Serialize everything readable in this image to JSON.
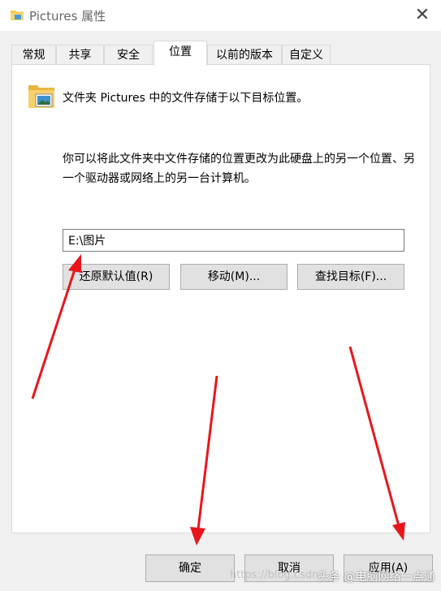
{
  "window": {
    "title": "Pictures 属性",
    "close_glyph": "✕"
  },
  "tabs": [
    {
      "label": "常规",
      "active": false
    },
    {
      "label": "共享",
      "active": false
    },
    {
      "label": "安全",
      "active": false
    },
    {
      "label": "位置",
      "active": true
    },
    {
      "label": "以前的版本",
      "active": false
    },
    {
      "label": "自定义",
      "active": false
    }
  ],
  "location": {
    "info_text": "文件夹 Pictures 中的文件存储于以下目标位置。",
    "description": "你可以将此文件夹中文件存储的位置更改为此硬盘上的另一个位置、另一个驱动器或网络上的另一台计算机。",
    "path_value": "E:\\图片",
    "restore_default_label": "还原默认值(R)",
    "move_label": "移动(M)...",
    "find_target_label": "查找目标(F)..."
  },
  "footer": {
    "ok_label": "确定",
    "cancel_label": "取消",
    "apply_label": "应用(A)"
  },
  "watermark": {
    "faint_text": "https://blog.csdn",
    "text": "头条 @电脑网络一点通"
  },
  "colors": {
    "arrow": "#e8161b",
    "button_face": "#e1e1e1",
    "window_bg": "#f0f0f0",
    "folder_yellow": "#f5c84a"
  },
  "icons": {
    "title": "folder-pictures-icon",
    "content": "folder-pictures-icon",
    "close": "close-icon"
  }
}
